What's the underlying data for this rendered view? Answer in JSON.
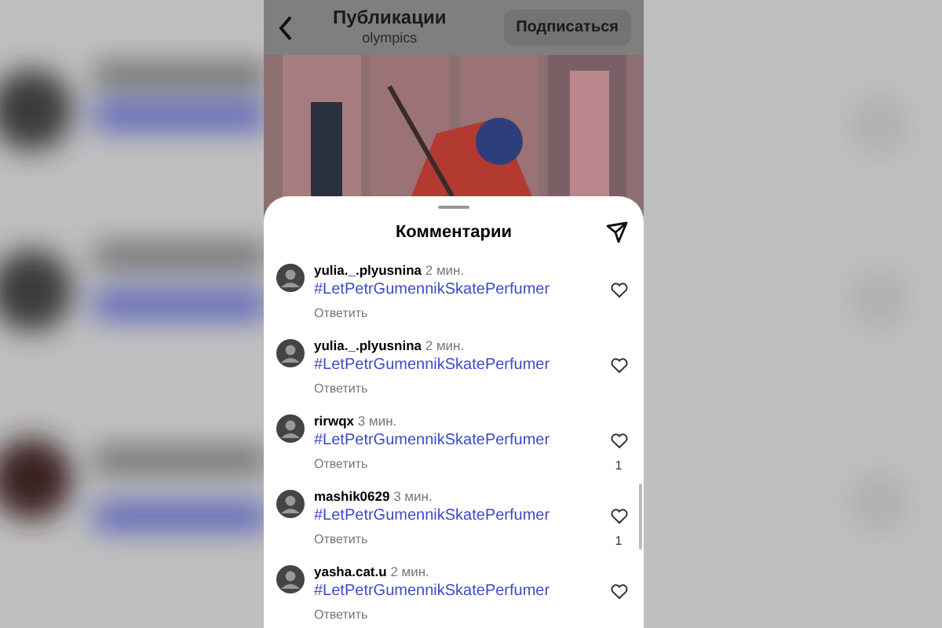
{
  "header": {
    "title": "Публикации",
    "subtitle": "olympics",
    "follow_button": "Подписаться"
  },
  "sheet": {
    "title": "Комментарии"
  },
  "comments": [
    {
      "username": "yulia._.plyusnina",
      "time": "2 мин.",
      "text": "#LetPetrGumennikSkatePerfumer",
      "reply": "Ответить"
    },
    {
      "username": "yulia._.plyusnina",
      "time": "2 мин.",
      "text": "#LetPetrGumennikSkatePerfumer",
      "reply": "Ответить"
    },
    {
      "username": "rirwqx",
      "time": "3 мин.",
      "text": "#LetPetrGumennikSkatePerfumer",
      "reply": "Ответить",
      "likes": "1"
    },
    {
      "username": "mashik0629",
      "time": "3 мин.",
      "text": "#LetPetrGumennikSkatePerfumer",
      "reply": "Ответить",
      "likes": "1"
    },
    {
      "username": "yasha.cat.u",
      "time": "2 мин.",
      "text": "#LetPetrGumennikSkatePerfumer",
      "reply": "Ответить"
    }
  ]
}
